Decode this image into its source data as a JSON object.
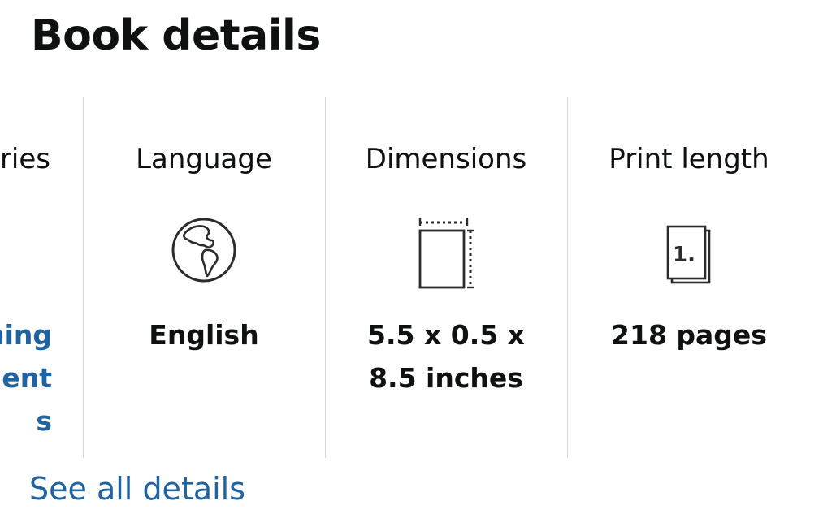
{
  "section": {
    "title": "Book details"
  },
  "columns": [
    {
      "label": "ries",
      "value": "ning\nment\ns",
      "icon": "series-icon"
    },
    {
      "label": "Language",
      "value": "English",
      "icon": "globe-icon"
    },
    {
      "label": "Dimensions",
      "value": "5.5 x 0.5 x 8.5 inches",
      "icon": "dimensions-icon"
    },
    {
      "label": "Print length",
      "value": "218 pages",
      "icon": "pages-icon"
    }
  ],
  "links": {
    "see_all": "See all details"
  },
  "colors": {
    "link": "#2162a1",
    "text": "#0f1111",
    "divider": "#d5d9d9"
  }
}
